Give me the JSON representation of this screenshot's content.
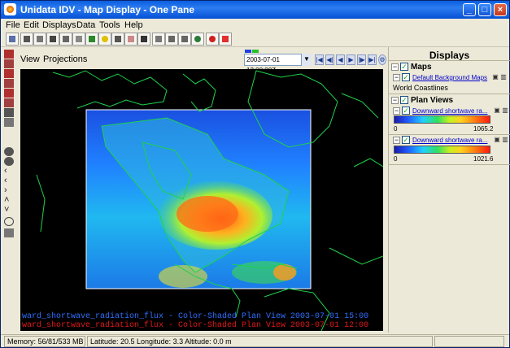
{
  "window": {
    "title": "Unidata IDV - Map Display - One Pane"
  },
  "menu": [
    "File",
    "Edit",
    "Displays",
    "Data",
    "Tools",
    "Help"
  ],
  "view": {
    "menu": [
      "View",
      "Projections"
    ],
    "time": "2003-07-01 12:00:00Z"
  },
  "map": {
    "legend_1": "ward_shortwave_radiation_flux - Color-Shaded Plan View 2003-07-01 15:00",
    "legend_2": "ward_shortwave_radiation_flux - Color-Shaded Plan View 2003-07-01 12:00",
    "legend_1_color": "#2f6fff",
    "legend_2_color": "#e01818"
  },
  "displays": {
    "header": "Displays",
    "maps_label": "Maps",
    "bg_maps_label": "Default Background Maps",
    "coastlines_label": "World Coastlines",
    "plan_views_label": "Plan Views",
    "plan_view_1": {
      "label": "Downward shortwave ra...",
      "min": "0",
      "max": "1065.2"
    },
    "plan_view_2": {
      "label": "Downward shortwave ra...",
      "min": "0",
      "max": "1021.6"
    }
  },
  "status": {
    "memory": "Memory: 56/81/533 MB",
    "position": "Latitude:  20.5 Longitude:   3.3 Altitude:   0.0 m"
  },
  "icons": [
    "app-icon",
    "minimize-icon",
    "maximize-icon",
    "close-icon",
    "globe-icon",
    "stop-icon",
    "zoom-in-icon",
    "zoom-out-icon",
    "lock-icon",
    "trash-icon"
  ]
}
